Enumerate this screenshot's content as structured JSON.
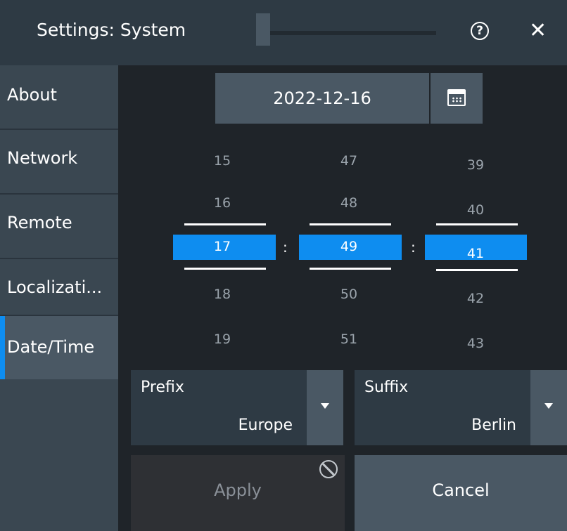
{
  "header": {
    "title": "Settings: System",
    "help_icon": "?",
    "close_icon": "✕"
  },
  "sidebar": {
    "items": [
      {
        "label": "About"
      },
      {
        "label": "Network"
      },
      {
        "label": "Remote"
      },
      {
        "label": "Localizati..."
      },
      {
        "label": "Date/Time"
      }
    ],
    "active": "Date/Time",
    "accent_color": "#0e8df0"
  },
  "date": {
    "value": "2022-12-16",
    "calendar_icon": "calendar-icon"
  },
  "time": {
    "hours": {
      "above": [
        "15",
        "16"
      ],
      "selected": "17",
      "below": [
        "18",
        "19"
      ]
    },
    "minutes": {
      "above": [
        "47",
        "48"
      ],
      "selected": "49",
      "below": [
        "50",
        "51"
      ]
    },
    "seconds": {
      "above": [
        "39",
        "40"
      ],
      "selected": "41",
      "below": [
        "42",
        "43"
      ]
    },
    "separator": ":"
  },
  "timezone": {
    "prefix": {
      "label": "Prefix",
      "value": "Europe"
    },
    "suffix": {
      "label": "Suffix",
      "value": "Berlin"
    }
  },
  "buttons": {
    "apply": "Apply",
    "cancel": "Cancel"
  }
}
